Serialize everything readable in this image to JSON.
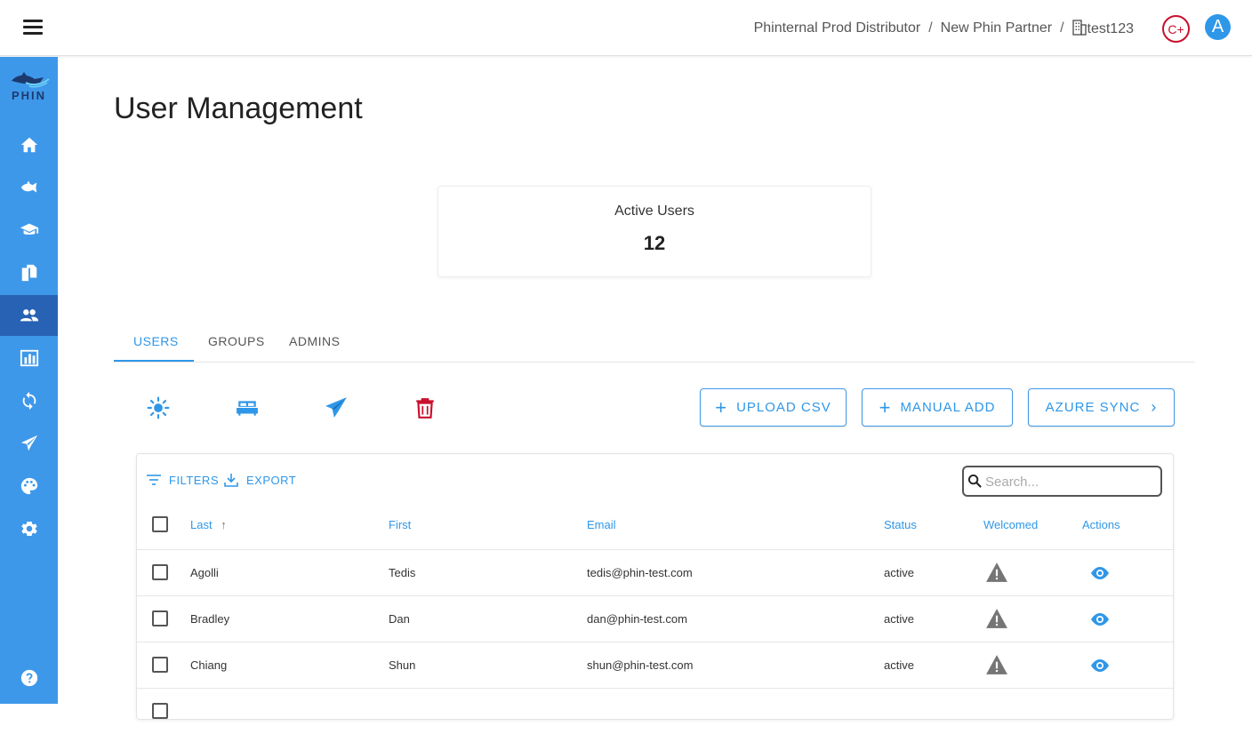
{
  "header": {
    "menu_icon": "hamburger-menu-icon",
    "breadcrumb": [
      "Phinternal Prod Distributor",
      "New Phin Partner",
      "test123"
    ],
    "breadcrumb_separator": "/",
    "credit_badge": "C+",
    "avatar_letter": "A"
  },
  "sidebar": {
    "logo_text": "PHIN",
    "items": [
      {
        "icon": "home-icon",
        "active": false
      },
      {
        "icon": "fish-icon",
        "active": false
      },
      {
        "icon": "graduation-cap-icon",
        "active": false
      },
      {
        "icon": "documents-icon",
        "active": false
      },
      {
        "icon": "users-icon",
        "active": true
      },
      {
        "icon": "bar-chart-icon",
        "active": false
      },
      {
        "icon": "sync-icon",
        "active": false
      },
      {
        "icon": "send-icon",
        "active": false
      },
      {
        "icon": "palette-icon",
        "active": false
      },
      {
        "icon": "settings-icon",
        "active": false
      }
    ],
    "help_icon": "help-icon"
  },
  "page": {
    "title": "User Management"
  },
  "stat": {
    "label": "Active Users",
    "value": "12"
  },
  "tabs": [
    "USERS",
    "GROUPS",
    "ADMINS"
  ],
  "active_tab": "USERS",
  "toolbar": {
    "icons": [
      "sun-icon",
      "bed-icon",
      "send-icon",
      "trash-icon"
    ],
    "upload_csv": "UPLOAD CSV",
    "manual_add": "MANUAL ADD",
    "azure_sync": "AZURE SYNC"
  },
  "table": {
    "filters": "FILTERS",
    "export": "EXPORT",
    "search_placeholder": "Search...",
    "columns": {
      "last": "Last",
      "first": "First",
      "email": "Email",
      "status": "Status",
      "welcomed": "Welcomed",
      "actions": "Actions"
    },
    "sort_indicator": "↑",
    "rows": [
      {
        "last": "Agolli",
        "first": "Tedis",
        "email": "tedis@phin-test.com",
        "status": "active"
      },
      {
        "last": "Bradley",
        "first": "Dan",
        "email": "dan@phin-test.com",
        "status": "active"
      },
      {
        "last": "Chiang",
        "first": "Shun",
        "email": "shun@phin-test.com",
        "status": "active"
      }
    ]
  },
  "colors": {
    "primary": "#2f97e8",
    "sidebar": "#3e98ea",
    "sidebar_active": "#2862b4",
    "danger": "#c8102e",
    "warning_icon": "#757575"
  }
}
